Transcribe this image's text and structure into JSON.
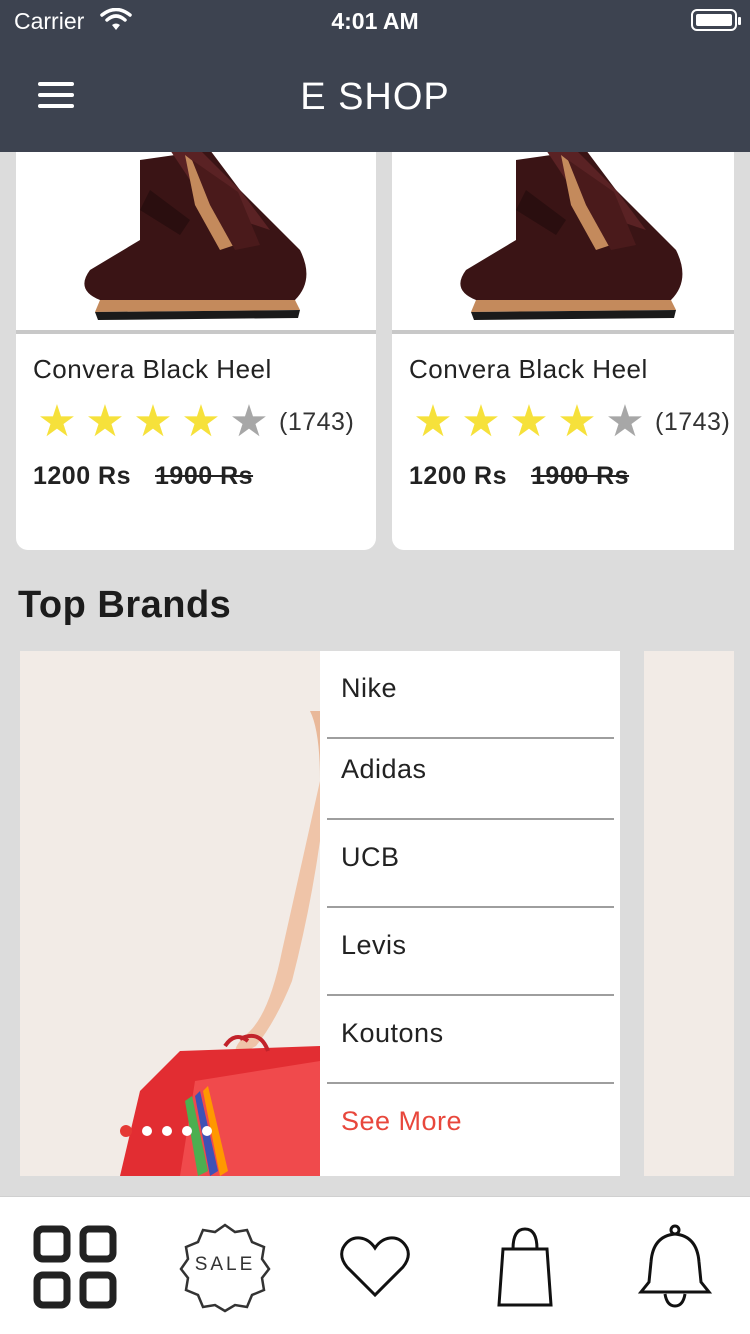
{
  "status_bar": {
    "carrier": "Carrier",
    "time": "4:01 AM"
  },
  "header": {
    "title": "E SHOP",
    "menu_icon": "hamburger-menu-icon"
  },
  "products": [
    {
      "name": "Convera Black Heel",
      "rating": 4,
      "rating_max": 5,
      "reviews": "(1743)",
      "price": "1200 Rs",
      "old_price": "1900 Rs"
    },
    {
      "name": "Convera Black Heel",
      "rating": 4,
      "rating_max": 5,
      "reviews": "(1743)",
      "price": "1200 Rs",
      "old_price": "1900 Rs"
    }
  ],
  "top_brands": {
    "title": "Top Brands",
    "brands": [
      "Nike",
      "Adidas",
      "UCB",
      "Levis",
      "Koutons"
    ],
    "see_more": "See More",
    "carousel": {
      "pages": 5,
      "active_page": 1
    }
  },
  "tab_bar": {
    "icons": [
      "categories-grid-icon",
      "sale-badge-icon",
      "heart-icon",
      "shopping-bag-icon",
      "bell-icon"
    ],
    "sale_text": "SALE"
  },
  "colors": {
    "header_bg": "#3d4350",
    "accent": "#e8473c",
    "star_on": "#f6e13b",
    "star_off": "#a7a7a7",
    "page_bg": "#dcdcdc"
  }
}
